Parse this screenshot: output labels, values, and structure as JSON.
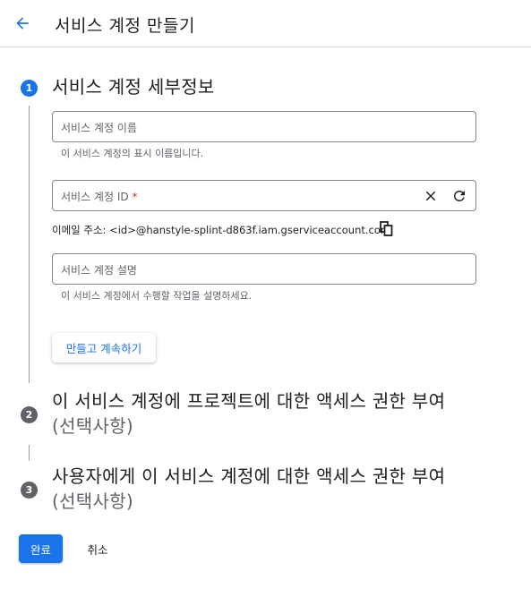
{
  "header": {
    "title": "서비스 계정 만들기",
    "back_icon": "arrow-left"
  },
  "steps": [
    {
      "number": "1",
      "title": "서비스 계정 세부정보",
      "fields": {
        "name": {
          "placeholder": "서비스 계정 이름",
          "hint": "이 서비스 계정의 표시 이름입니다."
        },
        "id": {
          "placeholder": "서비스 계정 ID",
          "required_mark": "*"
        },
        "email": {
          "label": "이메일 주소:",
          "value": "<id>@hanstyle-splint-d863f.iam.gserviceaccount.com"
        },
        "description": {
          "placeholder": "서비스 계정 설명",
          "hint": "이 서비스 계정에서 수행할 작업을 설명하세요."
        }
      },
      "continue_label": "만들고 계속하기"
    },
    {
      "number": "2",
      "title_line1": "이 서비스 계정에 프로젝트에 대한 액세스 권한 부여",
      "title_line2": "(선택사항)"
    },
    {
      "number": "3",
      "title_line1": "사용자에게 이 서비스 계정에 대한 액세스 권한 부여",
      "title_line2": "(선택사항)"
    }
  ],
  "actions": {
    "done_label": "완료",
    "cancel_label": "취소"
  },
  "colors": {
    "primary": "#1a73e8",
    "step_inactive": "#5f6368",
    "required": "#d93025"
  }
}
